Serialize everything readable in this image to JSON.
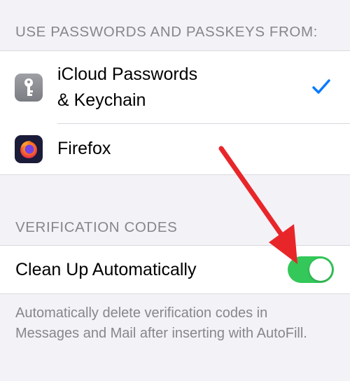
{
  "passwords_section": {
    "header": "USE PASSWORDS AND PASSKEYS FROM:",
    "items": [
      {
        "line1": "iCloud Passwords",
        "line2": "& Keychain",
        "icon": "key-icon",
        "selected": true
      },
      {
        "label": "Firefox",
        "icon": "firefox-icon",
        "selected": false
      }
    ]
  },
  "verification_section": {
    "header": "VERIFICATION CODES",
    "toggle_label": "Clean Up Automatically",
    "toggle_on": true,
    "footer": "Automatically delete verification codes in Messages and Mail after inserting with AutoFill."
  },
  "colors": {
    "toggle_on": "#34c759",
    "checkmark": "#0a7aff",
    "annotation_arrow": "#e8262a"
  }
}
